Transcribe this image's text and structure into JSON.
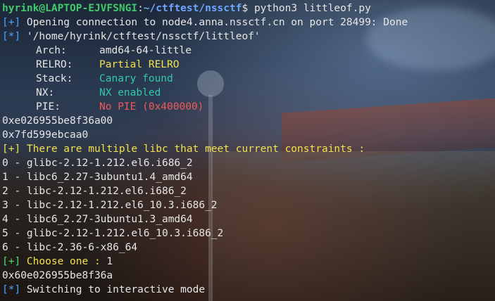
{
  "prompt": {
    "user_host": "hyrink@LAPTOP-EJVFSNGI",
    "colon": ":",
    "path": "~/ctftest/nssctf",
    "symbol": "$",
    "command": " python3 littleof.py"
  },
  "lines": {
    "opening_tag": "[+]",
    "opening": " Opening connection to node4.anna.nssctf.cn on port 28499: Done",
    "binary_tag": "[*]",
    "binary": " '/home/hyrink/ctftest/nssctf/littleof'",
    "checksec": [
      {
        "label": "Arch:",
        "value": "amd64-64-little"
      },
      {
        "label": "RELRO:",
        "value": "Partial RELRO"
      },
      {
        "label": "Stack:",
        "value": "Canary found"
      },
      {
        "label": "NX:",
        "value": "NX enabled"
      },
      {
        "label": "PIE:",
        "value": "No PIE (0x400000)"
      }
    ],
    "leak1": "0xe026955be8f36a00",
    "leak2": "0x7fd599ebcaa0",
    "libc_tag": "[+]",
    "libc_msg": " There are multiple libc that meet current constraints :",
    "libcs": [
      "0 - glibc-2.12-1.212.el6.i686_2",
      "1 - libc6_2.27-3ubuntu1.4_amd64",
      "2 - libc-2.12-1.212.el6.i686_2",
      "3 - libc-2.12-1.212.el6_10.3.i686_2",
      "4 - libc6_2.27-3ubuntu1.3_amd64",
      "5 - glibc-2.12-1.212.el6_10.3.i686_2",
      "6 - libc-2.36-6-x86_64"
    ],
    "choose_tag": "[+]",
    "choose_msg": " Choose one : ",
    "choose_val": "1",
    "leak3": "0x60e026955be8f36a",
    "switch_tag": "[*]",
    "switch_msg": " Switching to interactive mode"
  },
  "colors": {
    "user": "#41c96b",
    "path": "#6ea6ff",
    "tag_plus": "#4aa3ff",
    "highlight": "#f2e250",
    "ok": "#33c9a8",
    "bad": "#f05a5a"
  }
}
